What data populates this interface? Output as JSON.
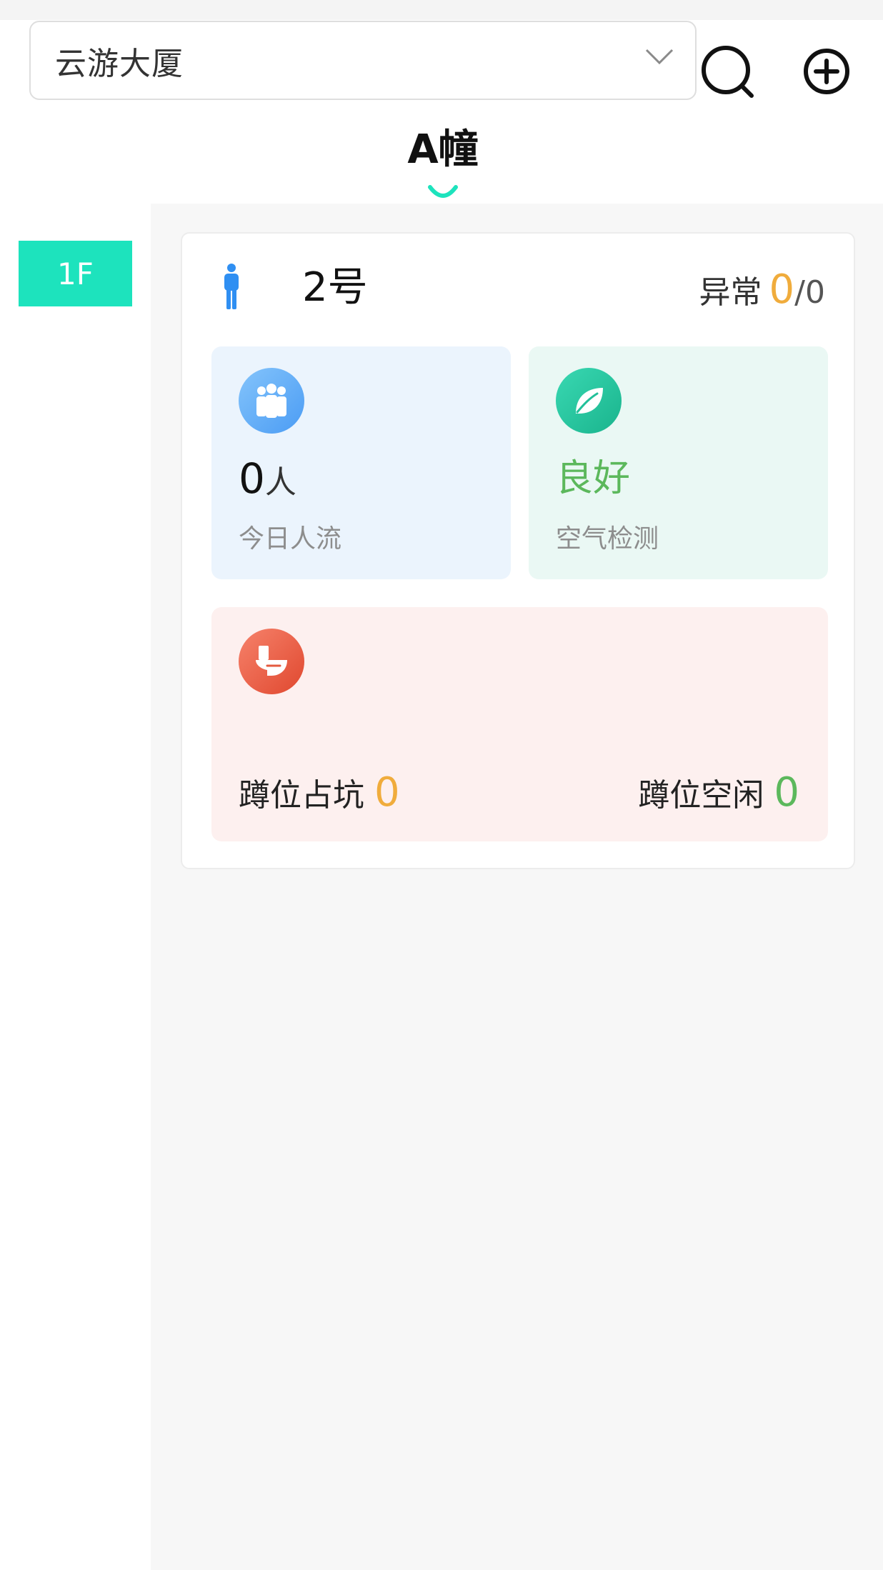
{
  "header": {
    "building_selector": {
      "value": "云游大厦"
    },
    "icons": {
      "search": "search-icon",
      "add": "plus-circle-icon",
      "dropdown": "chevron-down-icon"
    }
  },
  "tabs": [
    {
      "label": "A幢",
      "active": true
    }
  ],
  "floors": [
    {
      "label": "1F",
      "active": true
    }
  ],
  "device_card": {
    "name": "2号",
    "icon": "male-person-icon",
    "abnormal": {
      "label": "异常",
      "count": "0",
      "total": "/0"
    },
    "people_flow": {
      "value": "0",
      "unit": "人",
      "label": "今日人流",
      "icon": "people-group-icon"
    },
    "air_quality": {
      "value": "良好",
      "label": "空气检测",
      "icon": "leaf-icon"
    },
    "stalls": {
      "icon": "toilet-icon",
      "occupied_label": "蹲位占坑",
      "occupied_count": "0",
      "free_label": "蹲位空闲",
      "free_count": "0"
    }
  },
  "colors": {
    "accent": "#1de3bd",
    "warning": "#f0ac3c",
    "good": "#5cb85c",
    "person_blue": "#2f8ff2"
  }
}
